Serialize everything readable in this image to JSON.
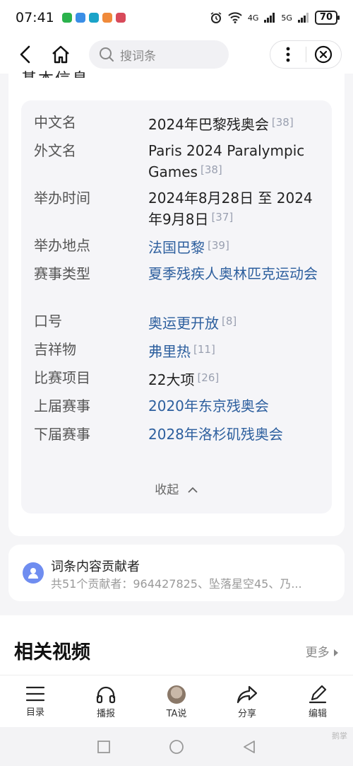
{
  "status_bar": {
    "time": "07:41",
    "network_label": "4G",
    "network_label_2": "5G",
    "battery": "70"
  },
  "nav": {
    "search_placeholder": "搜词条"
  },
  "info_card": {
    "cut_heading": "基本信息",
    "rows": [
      {
        "label": "中文名",
        "value": "2024年巴黎残奥会",
        "ref": "[38]"
      },
      {
        "label": "外文名",
        "value": "Paris 2024 Paralympic Games",
        "ref": "[38]"
      },
      {
        "label": "举办时间",
        "value": "2024年8月28日 至 2024年9月8日",
        "ref": "[37]"
      },
      {
        "label": "举办地点",
        "value": "法国巴黎",
        "ref": "[39]"
      },
      {
        "label": "赛事类型",
        "value": "夏季残疾人奥林匹克运动会",
        "ref": ""
      },
      {
        "label": "口号",
        "value": "奥运更开放",
        "ref": "[8]"
      },
      {
        "label": "吉祥物",
        "value": "弗里热",
        "ref": "[11]"
      },
      {
        "label": "比赛项目",
        "value": "22大项",
        "ref": "[26]"
      },
      {
        "label": "上届赛事",
        "value": "2020年东京残奥会",
        "ref": ""
      },
      {
        "label": "下届赛事",
        "value": "2028年洛杉矶残奥会",
        "ref": ""
      }
    ],
    "collapse_label": "收起"
  },
  "contributors": {
    "title": "词条内容贡献者",
    "subtitle": "共51个贡献者：964427825、坠落星空45、乃..."
  },
  "related": {
    "title": "相关视频",
    "more": "更多"
  },
  "toolbar": {
    "items": [
      {
        "label": "目录"
      },
      {
        "label": "播报"
      },
      {
        "label": "TA说"
      },
      {
        "label": "分享"
      },
      {
        "label": "编辑"
      }
    ]
  },
  "watermark": "鹅掌"
}
